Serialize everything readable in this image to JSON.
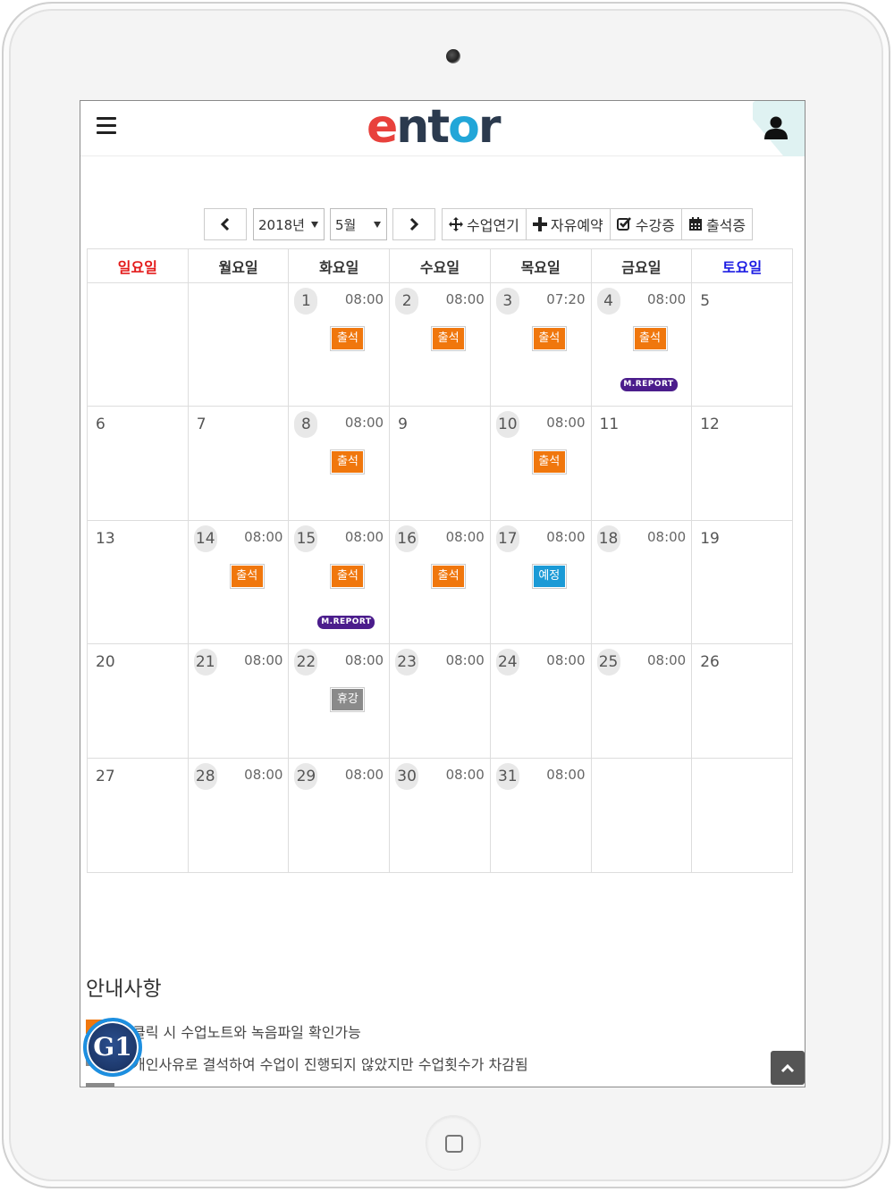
{
  "header": {
    "logo": {
      "part1": "e",
      "part2": "nt",
      "part3": "o",
      "part4": "r"
    }
  },
  "toolbar": {
    "year": "2018년",
    "month": "5월",
    "btn_postpone": "수업연기",
    "btn_free_reserve": "자유예약",
    "btn_enrollment": "수강증",
    "btn_attendance": "출석증"
  },
  "calendar": {
    "weekdays": [
      "일요일",
      "월요일",
      "화요일",
      "수요일",
      "목요일",
      "금요일",
      "토요일"
    ],
    "weeks": [
      [
        {
          "day": ""
        },
        {
          "day": ""
        },
        {
          "day": "1",
          "time": "08:00",
          "badge": "출석"
        },
        {
          "day": "2",
          "time": "08:00",
          "badge": "출석"
        },
        {
          "day": "3",
          "time": "07:20",
          "badge": "출석"
        },
        {
          "day": "4",
          "time": "08:00",
          "badge": "출석",
          "report": "M.REPORT"
        },
        {
          "day": "5"
        }
      ],
      [
        {
          "day": "6"
        },
        {
          "day": "7"
        },
        {
          "day": "8",
          "time": "08:00",
          "badge": "출석"
        },
        {
          "day": "9"
        },
        {
          "day": "10",
          "time": "08:00",
          "badge": "출석"
        },
        {
          "day": "11"
        },
        {
          "day": "12"
        }
      ],
      [
        {
          "day": "13"
        },
        {
          "day": "14",
          "time": "08:00",
          "badge": "출석"
        },
        {
          "day": "15",
          "time": "08:00",
          "badge": "출석",
          "report": "M.REPORT"
        },
        {
          "day": "16",
          "time": "08:00",
          "badge": "출석"
        },
        {
          "day": "17",
          "time": "08:00",
          "badge": "예정"
        },
        {
          "day": "18",
          "time": "08:00"
        },
        {
          "day": "19"
        }
      ],
      [
        {
          "day": "20"
        },
        {
          "day": "21",
          "time": "08:00"
        },
        {
          "day": "22",
          "time": "08:00",
          "badge": "휴강"
        },
        {
          "day": "23",
          "time": "08:00"
        },
        {
          "day": "24",
          "time": "08:00"
        },
        {
          "day": "25",
          "time": "08:00"
        },
        {
          "day": "26"
        }
      ],
      [
        {
          "day": "27"
        },
        {
          "day": "28",
          "time": "08:00"
        },
        {
          "day": "29",
          "time": "08:00"
        },
        {
          "day": "30",
          "time": "08:00"
        },
        {
          "day": "31",
          "time": "08:00"
        },
        {
          "day": ""
        },
        {
          "day": ""
        }
      ]
    ]
  },
  "notice": {
    "title": "안내사항",
    "line1": "클릭 시 수업노트와 녹음파일 확인가능",
    "line2": "개인사유로 결석하여 수업이 진행되지 않았지만 수업횟수가 차감됨"
  },
  "widgets": {
    "g1": "G1"
  },
  "colors": {
    "attend": "#f0770d",
    "scheduled": "#1b9ad6",
    "canceled": "#8a8a8a",
    "report": "#4b1d8c",
    "sunday": "#e31a1a",
    "saturday": "#1a1ae3"
  }
}
